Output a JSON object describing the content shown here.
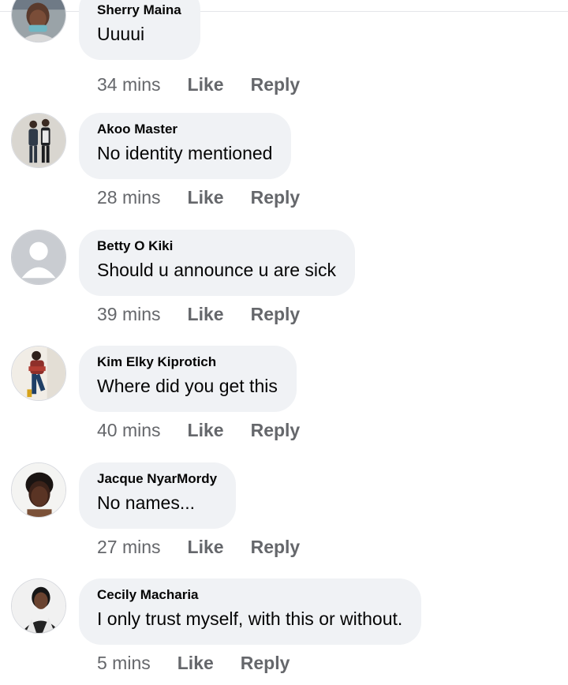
{
  "comments": [
    {
      "author": "Sherry Maina",
      "text": "Uuuui",
      "time": "34 mins",
      "like_label": "Like",
      "reply_label": "Reply",
      "avatar": "profile-photo"
    },
    {
      "author": "Akoo Master",
      "text": "No identity mentioned",
      "time": "28 mins",
      "like_label": "Like",
      "reply_label": "Reply",
      "avatar": "profile-photo"
    },
    {
      "author": "Betty O Kiki",
      "text": "Should u announce u are sick",
      "time": "39 mins",
      "like_label": "Like",
      "reply_label": "Reply",
      "avatar": "default-avatar-icon"
    },
    {
      "author": "Kim Elky Kiprotich",
      "text": "Where did you get this",
      "time": "40 mins",
      "like_label": "Like",
      "reply_label": "Reply",
      "avatar": "profile-photo"
    },
    {
      "author": "Jacque NyarMordy",
      "text": "No names...",
      "time": "27 mins",
      "like_label": "Like",
      "reply_label": "Reply",
      "avatar": "profile-photo"
    },
    {
      "author": "Cecily Macharia",
      "text": "I only trust myself, with this or without.",
      "time": "5 mins",
      "like_label": "Like",
      "reply_label": "Reply",
      "avatar": "profile-photo"
    }
  ],
  "colors": {
    "bubble_bg": "#f0f2f5",
    "text": "#050505",
    "secondary": "#65676b"
  }
}
